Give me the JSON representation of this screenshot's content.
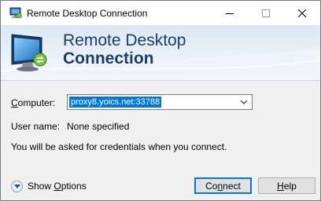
{
  "window": {
    "title": "Remote Desktop Connection",
    "icon": "remote-desktop-icon",
    "controls": [
      "minimize-icon",
      "maximize-icon",
      "close-icon"
    ]
  },
  "banner": {
    "line1": "Remote Desktop",
    "line2": "Connection",
    "accent_color": "#1a3e6b"
  },
  "form": {
    "computer_label_prefix": "C",
    "computer_label_rest": "omputer:",
    "computer_value": "proxy8.yoics.net:33788",
    "username_label": "User name:",
    "username_value": "None specified",
    "credentials_note": "You will be asked for credentials when you connect."
  },
  "footer": {
    "show_options_prefix": "Show ",
    "show_options_underlined": "O",
    "show_options_rest": "ptions",
    "connect_prefix": "Co",
    "connect_underlined": "n",
    "connect_rest": "nect",
    "help_underlined": "H",
    "help_rest": "elp"
  },
  "colors": {
    "selection": "#0078d7",
    "window_bg": "#f0f0f0"
  }
}
